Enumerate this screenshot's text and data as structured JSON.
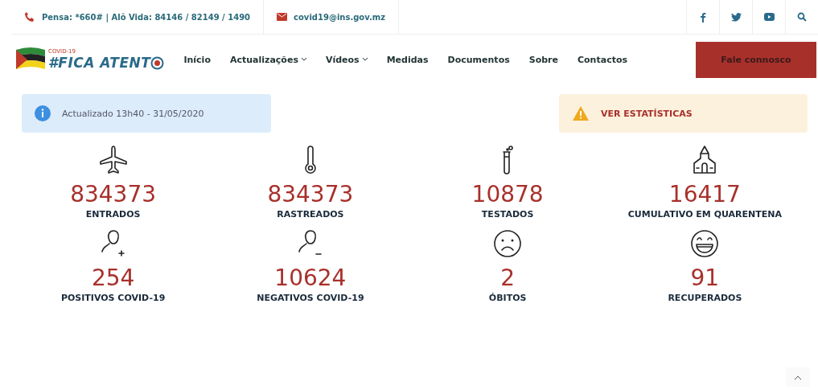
{
  "topbar": {
    "phone": "Pensa: *660# | Alô Vida: 84146 / 82149 / 1490",
    "email": "covid19@ins.gov.mz",
    "social": [
      {
        "kind": "facebook"
      },
      {
        "kind": "twitter"
      },
      {
        "kind": "youtube"
      },
      {
        "kind": "search"
      }
    ]
  },
  "logo": {
    "small": "COVID-19",
    "main": "#FICA ATENT"
  },
  "nav": [
    {
      "label": "Início",
      "has_dropdown": false
    },
    {
      "label": "Actualizações",
      "has_dropdown": true
    },
    {
      "label": "Vídeos",
      "has_dropdown": true
    },
    {
      "label": "Medidas",
      "has_dropdown": false
    },
    {
      "label": "Documentos",
      "has_dropdown": false
    },
    {
      "label": "Sobre",
      "has_dropdown": false
    },
    {
      "label": "Contactos",
      "has_dropdown": false
    }
  ],
  "contact_button": "Fale connosco",
  "alerts": [
    {
      "kind": "info",
      "text": "Actualizado 13h40 - 31/05/2020"
    },
    {
      "kind": "warning",
      "text": "VER ESTATÍSTICAS"
    }
  ],
  "stats": [
    {
      "kind": "plane",
      "value": "834373",
      "label": "ENTRADOS"
    },
    {
      "kind": "thermometer",
      "value": "834373",
      "label": "RASTREADOS"
    },
    {
      "kind": "tube",
      "value": "10878",
      "label": "TESTADOS"
    },
    {
      "kind": "building",
      "value": "16417",
      "label": "CUMULATIVO EM QUARENTENA"
    },
    {
      "kind": "person-plus",
      "value": "254",
      "label": "POSITIVOS COVID-19"
    },
    {
      "kind": "person-minus",
      "value": "10624",
      "label": "NEGATIVOS COVID-19"
    },
    {
      "kind": "sad",
      "value": "2",
      "label": "ÓBITOS"
    },
    {
      "kind": "happy",
      "value": "91",
      "label": "RECUPERADOS"
    }
  ]
}
